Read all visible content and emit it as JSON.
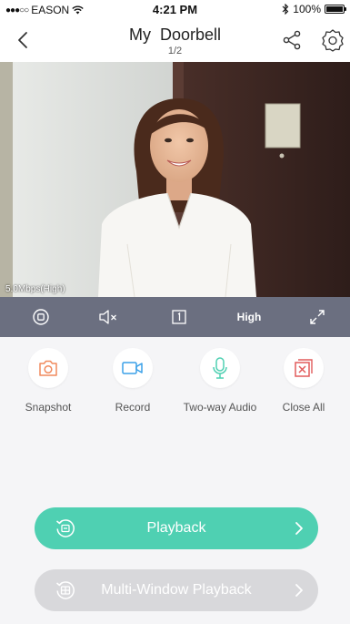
{
  "status": {
    "carrier": "EASON",
    "time": "4:21 PM",
    "battery": "100%"
  },
  "nav": {
    "title": "My  Doorbell",
    "subtitle": "1/2"
  },
  "video": {
    "bitrate": "5.0Mbps(High)"
  },
  "controls": {
    "quality": "High"
  },
  "actions": [
    {
      "label": "Snapshot",
      "icon": "camera-icon",
      "color": "#f08a5d"
    },
    {
      "label": "Record",
      "icon": "video-record-icon",
      "color": "#3aa0e8"
    },
    {
      "label": "Two-way Audio",
      "icon": "microphone-icon",
      "color": "#4fd0b2"
    },
    {
      "label": "Close All",
      "icon": "close-all-icon",
      "color": "#e25c5c"
    }
  ],
  "buttons": {
    "playback": "Playback",
    "multi_window_playback": "Multi-Window Playback"
  },
  "colors": {
    "accent": "#4fd0b2",
    "control_bar": "#6b6f80",
    "disabled": "#d8d8db"
  }
}
